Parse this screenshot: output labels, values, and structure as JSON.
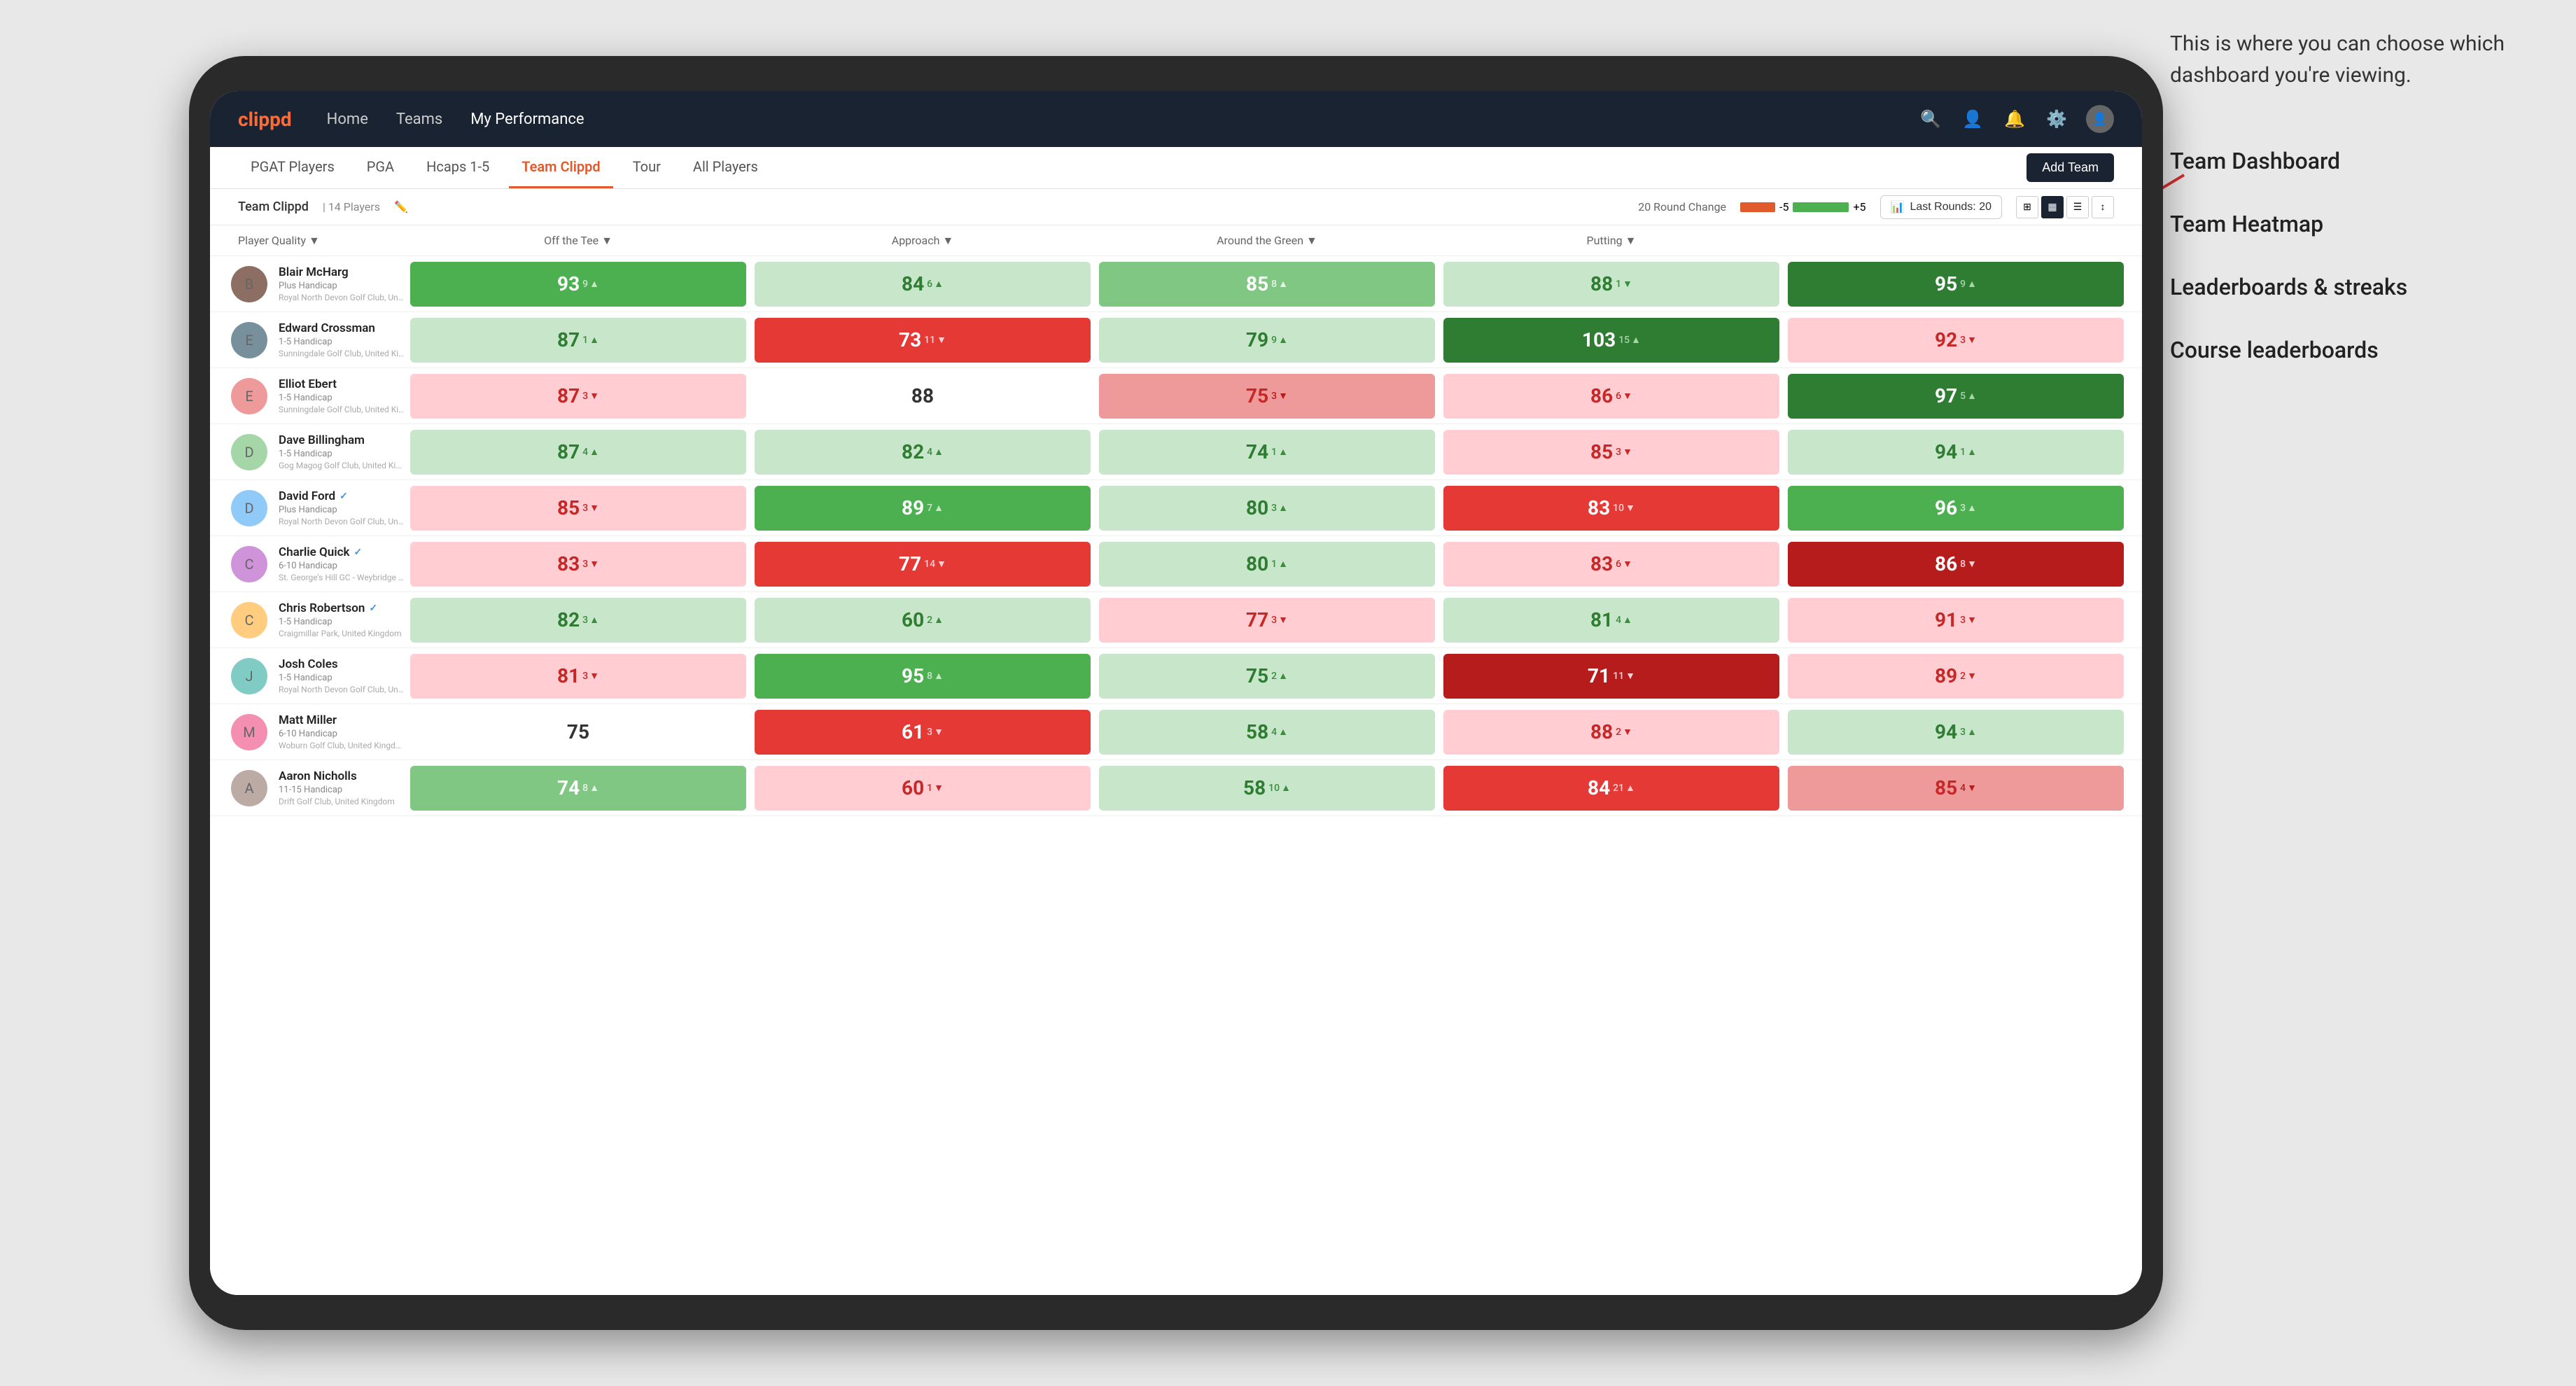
{
  "annotation": {
    "intro": "This is where you can choose which dashboard you're viewing.",
    "items": [
      "Team Dashboard",
      "Team Heatmap",
      "Leaderboards & streaks",
      "Course leaderboards"
    ]
  },
  "nav": {
    "logo": "clippd",
    "links": [
      {
        "label": "Home",
        "active": false
      },
      {
        "label": "Teams",
        "active": false
      },
      {
        "label": "My Performance",
        "active": false
      }
    ],
    "icons": [
      "search",
      "person",
      "bell",
      "settings",
      "avatar"
    ]
  },
  "sub_tabs": [
    {
      "label": "PGAT Players",
      "active": false
    },
    {
      "label": "PGA",
      "active": false
    },
    {
      "label": "Hcaps 1-5",
      "active": false
    },
    {
      "label": "Team Clippd",
      "active": true
    },
    {
      "label": "Tour",
      "active": false
    },
    {
      "label": "All Players",
      "active": false
    }
  ],
  "add_team_label": "Add Team",
  "team_info": {
    "name": "Team Clippd",
    "separator": "|",
    "count": "14 Players"
  },
  "round_change": {
    "label": "20 Round Change",
    "negative": "-5",
    "positive": "+5"
  },
  "last_rounds_btn": "Last Rounds: 20",
  "col_headers": [
    {
      "label": "Player Quality ▼",
      "key": "player_quality"
    },
    {
      "label": "Off the Tee ▼",
      "key": "off_tee"
    },
    {
      "label": "Approach ▼",
      "key": "approach"
    },
    {
      "label": "Around the Green ▼",
      "key": "around_green"
    },
    {
      "label": "Putting ▼",
      "key": "putting"
    }
  ],
  "players": [
    {
      "name": "Blair McHarg",
      "handicap": "Plus Handicap",
      "club": "Royal North Devon Golf Club, United Kingdom",
      "verified": false,
      "scores": [
        {
          "value": "93",
          "change": "9",
          "dir": "up",
          "bg": "bg-green-med"
        },
        {
          "value": "84",
          "change": "6",
          "dir": "up",
          "bg": "bg-green-pale"
        },
        {
          "value": "85",
          "change": "8",
          "dir": "up",
          "bg": "bg-green-light"
        },
        {
          "value": "88",
          "change": "1",
          "dir": "down",
          "bg": "bg-green-pale"
        },
        {
          "value": "95",
          "change": "9",
          "dir": "up",
          "bg": "bg-green-strong"
        }
      ]
    },
    {
      "name": "Edward Crossman",
      "handicap": "1-5 Handicap",
      "club": "Sunningdale Golf Club, United Kingdom",
      "verified": false,
      "scores": [
        {
          "value": "87",
          "change": "1",
          "dir": "up",
          "bg": "bg-green-pale"
        },
        {
          "value": "73",
          "change": "11",
          "dir": "down",
          "bg": "bg-red-med"
        },
        {
          "value": "79",
          "change": "9",
          "dir": "up",
          "bg": "bg-green-pale"
        },
        {
          "value": "103",
          "change": "15",
          "dir": "up",
          "bg": "bg-green-strong"
        },
        {
          "value": "92",
          "change": "3",
          "dir": "down",
          "bg": "bg-red-pale"
        }
      ]
    },
    {
      "name": "Elliot Ebert",
      "handicap": "1-5 Handicap",
      "club": "Sunningdale Golf Club, United Kingdom",
      "verified": false,
      "scores": [
        {
          "value": "87",
          "change": "3",
          "dir": "down",
          "bg": "bg-red-pale"
        },
        {
          "value": "88",
          "change": "",
          "dir": "",
          "bg": "bg-white"
        },
        {
          "value": "75",
          "change": "3",
          "dir": "down",
          "bg": "bg-red-light"
        },
        {
          "value": "86",
          "change": "6",
          "dir": "down",
          "bg": "bg-red-pale"
        },
        {
          "value": "97",
          "change": "5",
          "dir": "up",
          "bg": "bg-green-strong"
        }
      ]
    },
    {
      "name": "Dave Billingham",
      "handicap": "1-5 Handicap",
      "club": "Gog Magog Golf Club, United Kingdom",
      "verified": false,
      "scores": [
        {
          "value": "87",
          "change": "4",
          "dir": "up",
          "bg": "bg-green-pale"
        },
        {
          "value": "82",
          "change": "4",
          "dir": "up",
          "bg": "bg-green-pale"
        },
        {
          "value": "74",
          "change": "1",
          "dir": "up",
          "bg": "bg-green-pale"
        },
        {
          "value": "85",
          "change": "3",
          "dir": "down",
          "bg": "bg-red-pale"
        },
        {
          "value": "94",
          "change": "1",
          "dir": "up",
          "bg": "bg-green-pale"
        }
      ]
    },
    {
      "name": "David Ford",
      "handicap": "Plus Handicap",
      "club": "Royal North Devon Golf Club, United Kingdom",
      "verified": true,
      "scores": [
        {
          "value": "85",
          "change": "3",
          "dir": "down",
          "bg": "bg-red-pale"
        },
        {
          "value": "89",
          "change": "7",
          "dir": "up",
          "bg": "bg-green-med"
        },
        {
          "value": "80",
          "change": "3",
          "dir": "up",
          "bg": "bg-green-pale"
        },
        {
          "value": "83",
          "change": "10",
          "dir": "down",
          "bg": "bg-red-med"
        },
        {
          "value": "96",
          "change": "3",
          "dir": "up",
          "bg": "bg-green-med"
        }
      ]
    },
    {
      "name": "Charlie Quick",
      "handicap": "6-10 Handicap",
      "club": "St. George's Hill GC - Weybridge - Surrey, Uni...",
      "verified": true,
      "scores": [
        {
          "value": "83",
          "change": "3",
          "dir": "down",
          "bg": "bg-red-pale"
        },
        {
          "value": "77",
          "change": "14",
          "dir": "down",
          "bg": "bg-red-med"
        },
        {
          "value": "80",
          "change": "1",
          "dir": "up",
          "bg": "bg-green-pale"
        },
        {
          "value": "83",
          "change": "6",
          "dir": "down",
          "bg": "bg-red-pale"
        },
        {
          "value": "86",
          "change": "8",
          "dir": "down",
          "bg": "bg-red-strong"
        }
      ]
    },
    {
      "name": "Chris Robertson",
      "handicap": "1-5 Handicap",
      "club": "Craigmillar Park, United Kingdom",
      "verified": true,
      "scores": [
        {
          "value": "82",
          "change": "3",
          "dir": "up",
          "bg": "bg-green-pale"
        },
        {
          "value": "60",
          "change": "2",
          "dir": "up",
          "bg": "bg-green-pale"
        },
        {
          "value": "77",
          "change": "3",
          "dir": "down",
          "bg": "bg-red-pale"
        },
        {
          "value": "81",
          "change": "4",
          "dir": "up",
          "bg": "bg-green-pale"
        },
        {
          "value": "91",
          "change": "3",
          "dir": "down",
          "bg": "bg-red-pale"
        }
      ]
    },
    {
      "name": "Josh Coles",
      "handicap": "1-5 Handicap",
      "club": "Royal North Devon Golf Club, United Kingdom",
      "verified": false,
      "scores": [
        {
          "value": "81",
          "change": "3",
          "dir": "down",
          "bg": "bg-red-pale"
        },
        {
          "value": "95",
          "change": "8",
          "dir": "up",
          "bg": "bg-green-med"
        },
        {
          "value": "75",
          "change": "2",
          "dir": "up",
          "bg": "bg-green-pale"
        },
        {
          "value": "71",
          "change": "11",
          "dir": "down",
          "bg": "bg-red-strong"
        },
        {
          "value": "89",
          "change": "2",
          "dir": "down",
          "bg": "bg-red-pale"
        }
      ]
    },
    {
      "name": "Matt Miller",
      "handicap": "6-10 Handicap",
      "club": "Woburn Golf Club, United Kingdom",
      "verified": false,
      "scores": [
        {
          "value": "75",
          "change": "",
          "dir": "",
          "bg": "bg-white"
        },
        {
          "value": "61",
          "change": "3",
          "dir": "down",
          "bg": "bg-red-med"
        },
        {
          "value": "58",
          "change": "4",
          "dir": "up",
          "bg": "bg-green-pale"
        },
        {
          "value": "88",
          "change": "2",
          "dir": "down",
          "bg": "bg-red-pale"
        },
        {
          "value": "94",
          "change": "3",
          "dir": "up",
          "bg": "bg-green-pale"
        }
      ]
    },
    {
      "name": "Aaron Nicholls",
      "handicap": "11-15 Handicap",
      "club": "Drift Golf Club, United Kingdom",
      "verified": false,
      "scores": [
        {
          "value": "74",
          "change": "8",
          "dir": "up",
          "bg": "bg-green-light"
        },
        {
          "value": "60",
          "change": "1",
          "dir": "down",
          "bg": "bg-red-pale"
        },
        {
          "value": "58",
          "change": "10",
          "dir": "up",
          "bg": "bg-green-pale"
        },
        {
          "value": "84",
          "change": "21",
          "dir": "up",
          "bg": "bg-red-med"
        },
        {
          "value": "85",
          "change": "4",
          "dir": "down",
          "bg": "bg-red-light"
        }
      ]
    }
  ]
}
